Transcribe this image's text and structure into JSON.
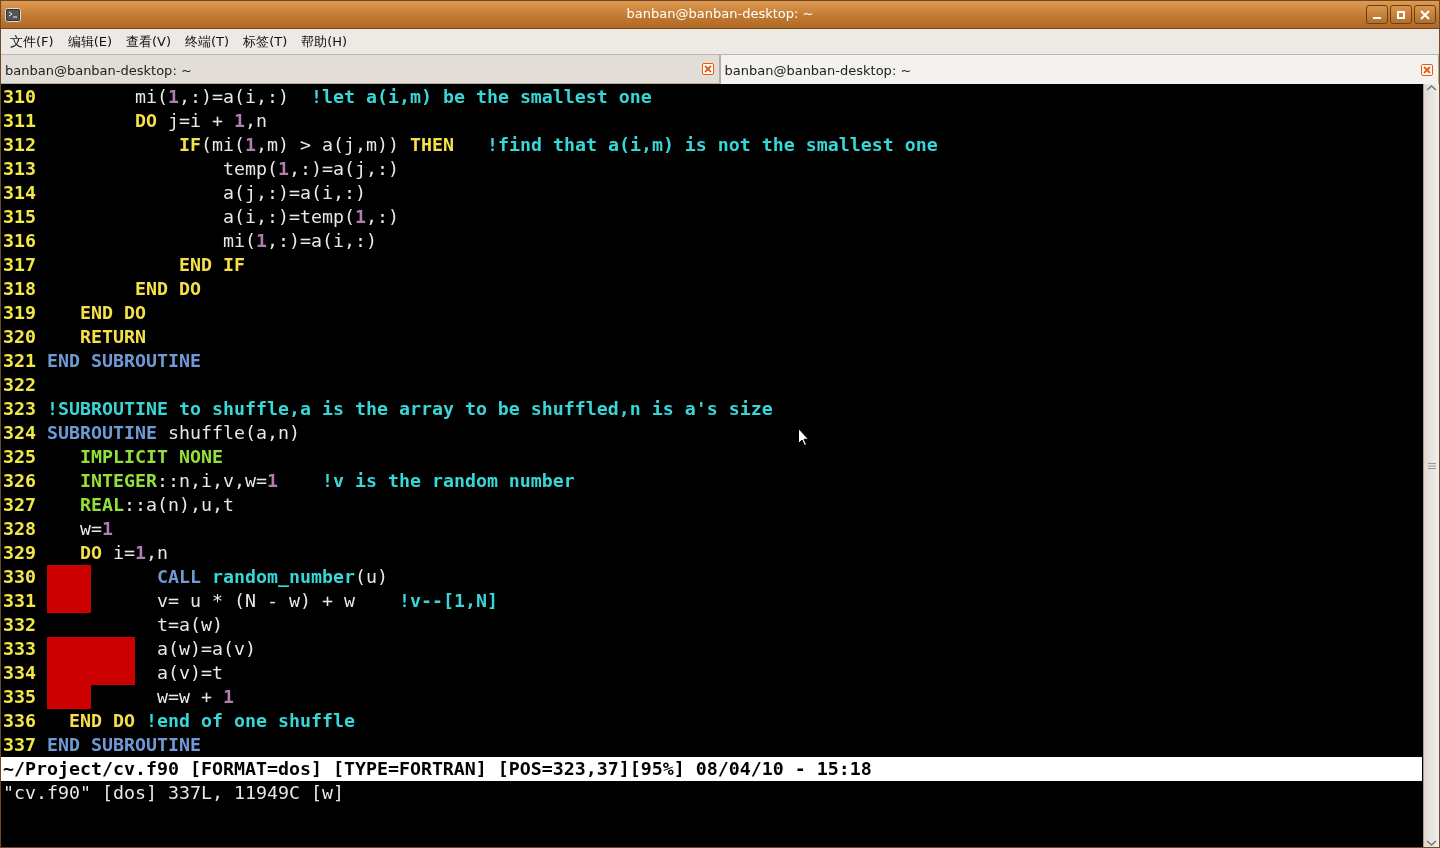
{
  "window": {
    "title": "banban@banban-desktop: ~"
  },
  "menu": [
    {
      "label": "文件(F)"
    },
    {
      "label": "编辑(E)"
    },
    {
      "label": "查看(V)"
    },
    {
      "label": "终端(T)"
    },
    {
      "label": "标签(T)"
    },
    {
      "label": "帮助(H)"
    }
  ],
  "tabs": [
    {
      "label": "banban@banban-desktop: ~",
      "selected": false
    },
    {
      "label": "banban@banban-desktop: ~",
      "selected": true
    }
  ],
  "editor": {
    "lines": [
      {
        "number": "310",
        "segments": [
          {
            "kind": "plain",
            "text": "        mi("
          },
          {
            "kind": "number",
            "text": "1"
          },
          {
            "kind": "plain",
            "text": ",:)=a(i,:)  "
          },
          {
            "kind": "comment",
            "text": "!let a(i,m) be the smallest one"
          }
        ]
      },
      {
        "number": "311",
        "segments": [
          {
            "kind": "keyword",
            "text": "        DO"
          },
          {
            "kind": "plain",
            "text": " j=i + "
          },
          {
            "kind": "number",
            "text": "1"
          },
          {
            "kind": "plain",
            "text": ",n"
          }
        ]
      },
      {
        "number": "312",
        "segments": [
          {
            "kind": "keyword",
            "text": "            IF"
          },
          {
            "kind": "plain",
            "text": "(mi("
          },
          {
            "kind": "number",
            "text": "1"
          },
          {
            "kind": "plain",
            "text": ",m) > a(j,m)) "
          },
          {
            "kind": "keyword",
            "text": "THEN"
          },
          {
            "kind": "comment",
            "text": "   !find that a(i,m) is not the smallest one"
          }
        ]
      },
      {
        "number": "313",
        "segments": [
          {
            "kind": "plain",
            "text": "                temp("
          },
          {
            "kind": "number",
            "text": "1"
          },
          {
            "kind": "plain",
            "text": ",:)=a(j,:)"
          }
        ]
      },
      {
        "number": "314",
        "segments": [
          {
            "kind": "plain",
            "text": "                a(j,:)=a(i,:)"
          }
        ]
      },
      {
        "number": "315",
        "segments": [
          {
            "kind": "plain",
            "text": "                a(i,:)=temp("
          },
          {
            "kind": "number",
            "text": "1"
          },
          {
            "kind": "plain",
            "text": ",:)"
          }
        ]
      },
      {
        "number": "316",
        "segments": [
          {
            "kind": "plain",
            "text": "                mi("
          },
          {
            "kind": "number",
            "text": "1"
          },
          {
            "kind": "plain",
            "text": ",:)=a(i,:)"
          }
        ]
      },
      {
        "number": "317",
        "segments": [
          {
            "kind": "keyword",
            "text": "            END IF"
          }
        ]
      },
      {
        "number": "318",
        "segments": [
          {
            "kind": "keyword",
            "text": "        END DO"
          }
        ]
      },
      {
        "number": "319",
        "segments": [
          {
            "kind": "keyword",
            "text": "   END DO"
          }
        ]
      },
      {
        "number": "320",
        "segments": [
          {
            "kind": "keyword",
            "text": "   RETURN"
          }
        ]
      },
      {
        "number": "321",
        "segments": [
          {
            "kind": "unit",
            "text": "END SUBROUTINE"
          }
        ]
      },
      {
        "number": "322"
      },
      {
        "number": "323",
        "segments": [
          {
            "kind": "comment",
            "text": "!SUBROUTINE to shuffle,a is the array to be shuffled,n is a's size"
          }
        ]
      },
      {
        "number": "324",
        "segments": [
          {
            "kind": "unit",
            "text": "SUBROUTINE"
          },
          {
            "kind": "plain",
            "text": " shuffle(a,n)"
          }
        ]
      },
      {
        "number": "325",
        "segments": [
          {
            "kind": "type",
            "text": "   IMPLICIT NONE"
          }
        ]
      },
      {
        "number": "326",
        "segments": [
          {
            "kind": "type",
            "text": "   INTEGER"
          },
          {
            "kind": "plain",
            "text": "::n,i,v,w="
          },
          {
            "kind": "number",
            "text": "1"
          },
          {
            "kind": "comment",
            "text": "    !v is the random number"
          }
        ]
      },
      {
        "number": "327",
        "segments": [
          {
            "kind": "type",
            "text": "   REAL"
          },
          {
            "kind": "plain",
            "text": "::a(n),u,t"
          }
        ]
      },
      {
        "number": "328",
        "segments": [
          {
            "kind": "plain",
            "text": "   w="
          },
          {
            "kind": "number",
            "text": "1"
          }
        ]
      },
      {
        "number": "329",
        "segments": [
          {
            "kind": "keyword",
            "text": "   DO"
          },
          {
            "kind": "plain",
            "text": " i="
          },
          {
            "kind": "number",
            "text": "1"
          },
          {
            "kind": "plain",
            "text": ",n"
          }
        ]
      },
      {
        "number": "330",
        "segments": [
          {
            "kind": "tab_error"
          },
          {
            "kind": "unit",
            "text": "      CALL "
          },
          {
            "kind": "intrinsic",
            "text": "random_number"
          },
          {
            "kind": "plain",
            "text": "(u)"
          }
        ]
      },
      {
        "number": "331",
        "segments": [
          {
            "kind": "tab_error"
          },
          {
            "kind": "plain",
            "text": "      v= u * (N - w) + w    "
          },
          {
            "kind": "comment",
            "text": "!v--[1,N]"
          }
        ]
      },
      {
        "number": "332",
        "segments": [
          {
            "kind": "plain",
            "text": "          t=a(w)"
          }
        ]
      },
      {
        "number": "333",
        "segments": [
          {
            "kind": "tab_error"
          },
          {
            "kind": "tab_error"
          },
          {
            "kind": "plain",
            "text": "  a(w)=a(v)"
          }
        ]
      },
      {
        "number": "334",
        "segments": [
          {
            "kind": "tab_error"
          },
          {
            "kind": "tab_error"
          },
          {
            "kind": "plain",
            "text": "  a(v)=t"
          }
        ]
      },
      {
        "number": "335",
        "segments": [
          {
            "kind": "tab_error"
          },
          {
            "kind": "plain",
            "text": "      w=w + "
          },
          {
            "kind": "number",
            "text": "1"
          }
        ]
      },
      {
        "number": "336",
        "segments": [
          {
            "kind": "keyword",
            "text": "  END DO"
          },
          {
            "kind": "comment",
            "text": " !end of one shuffle"
          }
        ]
      },
      {
        "number": "337",
        "segments": [
          {
            "kind": "unit",
            "text": "END SUBROUTINE"
          }
        ]
      }
    ],
    "status_line": "~/Project/cv.f90 [FORMAT=dos] [TYPE=FORTRAN] [POS=323,37][95%] 08/04/10 - 15:18",
    "message": "\"cv.f90\" [dos] 337L, 11949C [w]"
  }
}
